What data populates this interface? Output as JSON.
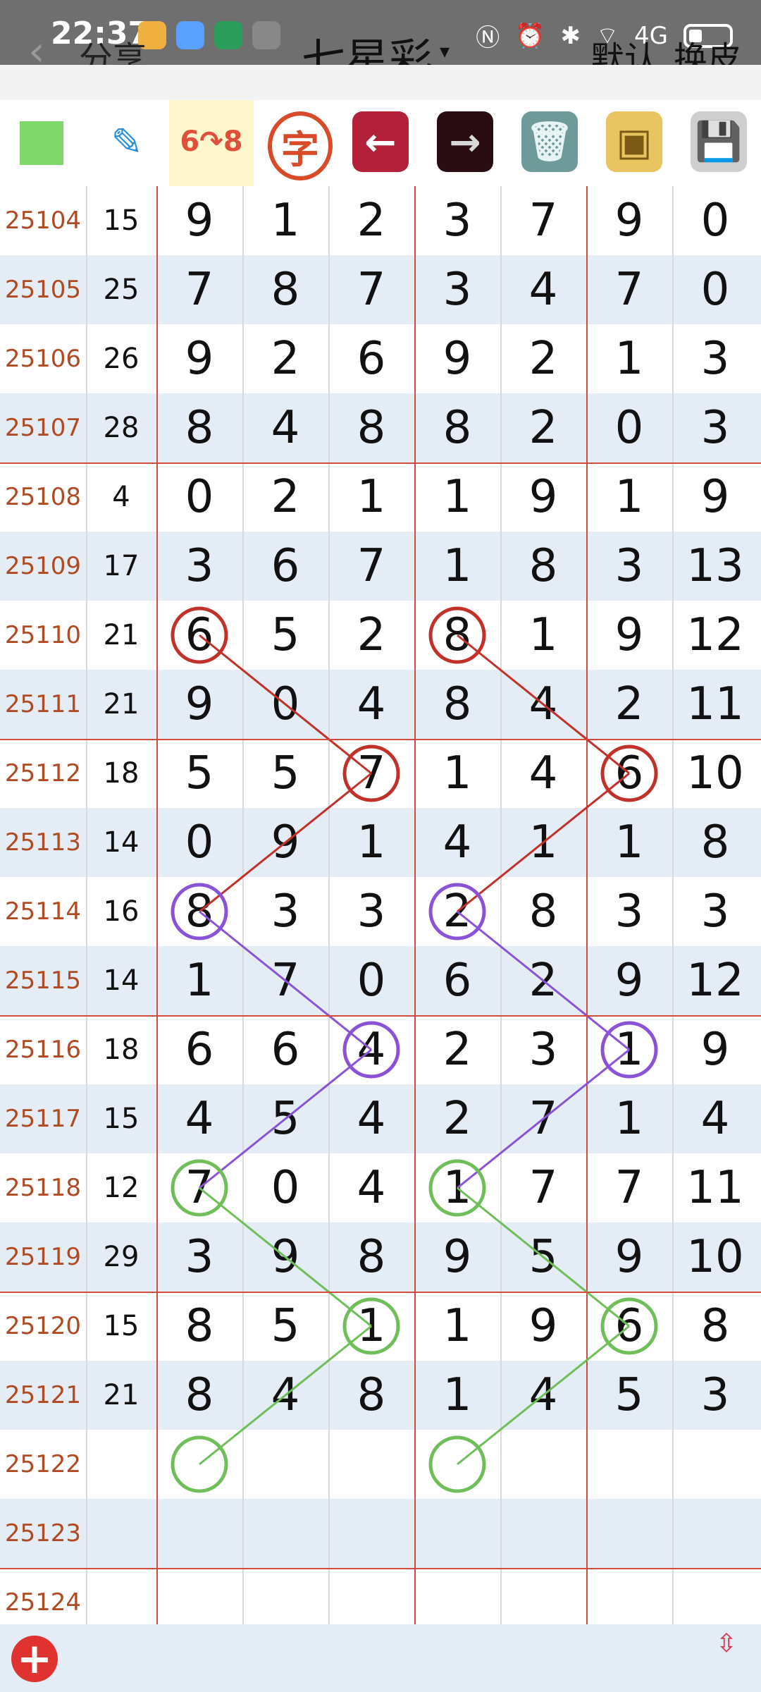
{
  "status_bar": {
    "time": "22:37",
    "network": "4G"
  },
  "header": {
    "back": "‹",
    "share": "分享",
    "title": "七星彩",
    "caret": "▾",
    "default": "默认",
    "skin": "换皮"
  },
  "toolbar": {
    "items": [
      {
        "name": "color-square",
        "glyph": ""
      },
      {
        "name": "pen",
        "glyph": "✎"
      },
      {
        "name": "curve",
        "glyph": "6↷8"
      },
      {
        "name": "zi",
        "glyph": "字"
      },
      {
        "name": "arrow-left",
        "glyph": "←"
      },
      {
        "name": "arrow-right",
        "glyph": "→"
      },
      {
        "name": "trash",
        "glyph": "🗑"
      },
      {
        "name": "photo",
        "glyph": "▣"
      },
      {
        "name": "disk",
        "glyph": "💾"
      }
    ]
  },
  "rows": [
    {
      "issue": "25104",
      "sum": "15",
      "d": [
        "9",
        "1",
        "2",
        "3",
        "7",
        "9",
        "0"
      ]
    },
    {
      "issue": "25105",
      "sum": "25",
      "d": [
        "7",
        "8",
        "7",
        "3",
        "4",
        "7",
        "0"
      ]
    },
    {
      "issue": "25106",
      "sum": "26",
      "d": [
        "9",
        "2",
        "6",
        "9",
        "2",
        "1",
        "3"
      ]
    },
    {
      "issue": "25107",
      "sum": "28",
      "d": [
        "8",
        "4",
        "8",
        "8",
        "2",
        "0",
        "3"
      ]
    },
    {
      "issue": "25108",
      "sum": "4",
      "d": [
        "0",
        "2",
        "1",
        "1",
        "9",
        "1",
        "9"
      ]
    },
    {
      "issue": "25109",
      "sum": "17",
      "d": [
        "3",
        "6",
        "7",
        "1",
        "8",
        "3",
        "13"
      ]
    },
    {
      "issue": "25110",
      "sum": "21",
      "d": [
        "6",
        "5",
        "2",
        "8",
        "1",
        "9",
        "12"
      ]
    },
    {
      "issue": "25111",
      "sum": "21",
      "d": [
        "9",
        "0",
        "4",
        "8",
        "4",
        "2",
        "11"
      ]
    },
    {
      "issue": "25112",
      "sum": "18",
      "d": [
        "5",
        "5",
        "7",
        "1",
        "4",
        "6",
        "10"
      ]
    },
    {
      "issue": "25113",
      "sum": "14",
      "d": [
        "0",
        "9",
        "1",
        "4",
        "1",
        "1",
        "8"
      ]
    },
    {
      "issue": "25114",
      "sum": "16",
      "d": [
        "8",
        "3",
        "3",
        "2",
        "8",
        "3",
        "3"
      ]
    },
    {
      "issue": "25115",
      "sum": "14",
      "d": [
        "1",
        "7",
        "0",
        "6",
        "2",
        "9",
        "12"
      ]
    },
    {
      "issue": "25116",
      "sum": "18",
      "d": [
        "6",
        "6",
        "4",
        "2",
        "3",
        "1",
        "9"
      ]
    },
    {
      "issue": "25117",
      "sum": "15",
      "d": [
        "4",
        "5",
        "4",
        "2",
        "7",
        "1",
        "4"
      ]
    },
    {
      "issue": "25118",
      "sum": "12",
      "d": [
        "7",
        "0",
        "4",
        "1",
        "7",
        "7",
        "11"
      ]
    },
    {
      "issue": "25119",
      "sum": "29",
      "d": [
        "3",
        "9",
        "8",
        "9",
        "5",
        "9",
        "10"
      ]
    },
    {
      "issue": "25120",
      "sum": "15",
      "d": [
        "8",
        "5",
        "1",
        "1",
        "9",
        "6",
        "8"
      ]
    },
    {
      "issue": "25121",
      "sum": "21",
      "d": [
        "8",
        "4",
        "8",
        "1",
        "4",
        "5",
        "3"
      ]
    },
    {
      "issue": "25122",
      "sum": "",
      "d": [
        "",
        "",
        "",
        "",
        "",
        "",
        ""
      ]
    },
    {
      "issue": "25123",
      "sum": "",
      "d": [
        "",
        "",
        "",
        "",
        "",
        "",
        ""
      ]
    },
    {
      "issue": "25124",
      "sum": "",
      "d": [
        "",
        "",
        "",
        "",
        "",
        "",
        ""
      ]
    }
  ],
  "annotations": {
    "colors": {
      "red": "#c2302a",
      "purple": "#8a52d6",
      "green": "#6fbe5a"
    }
  },
  "bottom": {
    "add": "+",
    "scroll": "⇳"
  }
}
